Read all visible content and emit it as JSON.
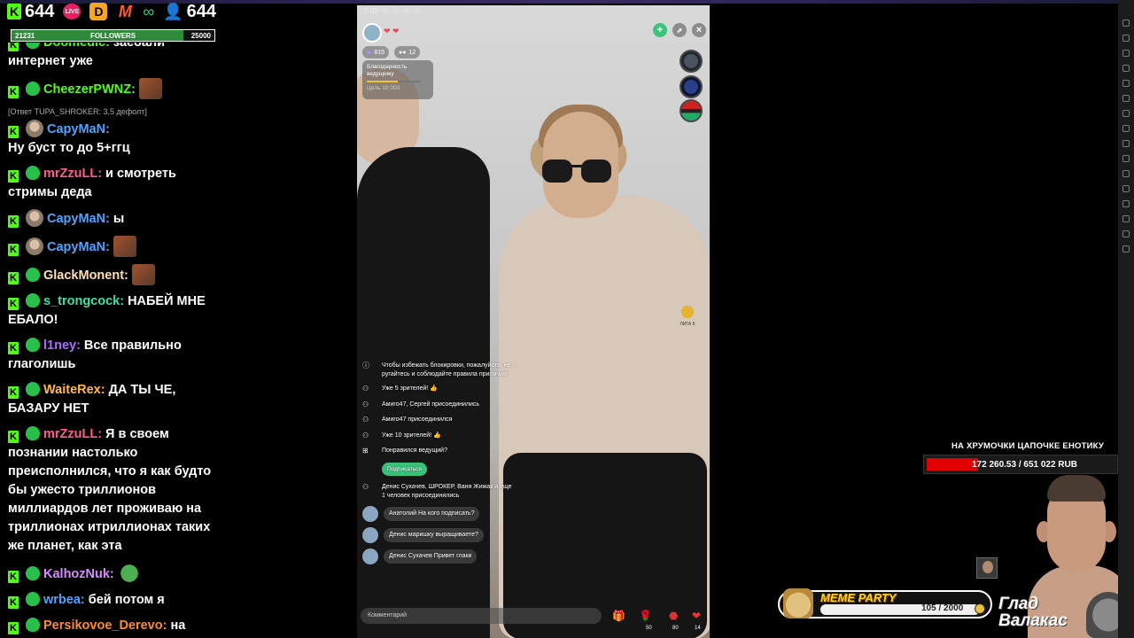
{
  "topbar": {
    "kick_count": "644",
    "live_badge": "LIVE",
    "viewer_count": "644"
  },
  "followers": {
    "current": "21231",
    "label": "FOLLOWERS",
    "goal": "25000",
    "progress": 0.849
  },
  "chat": {
    "messages": [
      {
        "user": "Doomedic:",
        "text": "заебали",
        "cont": "интернет уже",
        "color": "#53fc18"
      },
      {
        "user": "CheezerPWNZ:",
        "text": "",
        "color": "#53fc18"
      },
      {
        "user": "CapyMaN:",
        "text": "",
        "color": "#4ea5ff",
        "reply": "[Ответ TUPA_SHROKER: 3,5 дефолт]",
        "cont": "Ну буст то до 5+ггц"
      },
      {
        "user": "mrZzuLL:",
        "text": "и смотреть",
        "cont": "стримы деда",
        "color": "#ff5c8a"
      },
      {
        "user": "CapyMaN:",
        "text": "ы",
        "color": "#4ea5ff"
      },
      {
        "user": "CapyMaN:",
        "text": "",
        "color": "#4ea5ff"
      },
      {
        "user": "GlackMonent:",
        "text": "",
        "color": "#ffe0b0"
      },
      {
        "user": "s_trongcock:",
        "text": "НАБЕЙ МНЕ",
        "cont": "ЕБАЛО!",
        "color": "#3ee0a0"
      },
      {
        "user": "l1ney:",
        "text": "Все правильно",
        "cont": "глаголишь",
        "color": "#a96cff"
      },
      {
        "user": "WaiteRex:",
        "text": "ДА ТЫ ЧЕ,",
        "cont": "БАЗАРУ НЕТ",
        "color": "#ffb84a"
      },
      {
        "user": "mrZzuLL:",
        "text": "Я в своем",
        "cont": "познании настолько преисполнился, что я как будто бы ужесто триллионов миллиардов лет проживаю на триллионах итриллионах таких же планет, как эта",
        "color": "#ff5c8a"
      },
      {
        "user": "KalhozNuk:",
        "text": "",
        "color": "#d58cff"
      },
      {
        "user": "wrbea:",
        "text": "бей потом я",
        "color": "#4ea5ff"
      },
      {
        "user": "Persikovoe_Derevo:",
        "text": "на",
        "cont": "зарплате)))",
        "color": "#ff8c2a"
      }
    ]
  },
  "phone": {
    "time": "7:02",
    "pill_815": "815",
    "pill_12": "12",
    "thanks_title": "Благодарность ведущему",
    "thanks_goal": "Цель 10 000",
    "league": "ЛИГА 5",
    "system_msg": "Чтобы избежать блокировки, пожалуйста, не ругайтесь и соблюдайте правила приличия",
    "events": [
      "Уже 5 зрителей! 👍",
      "Амиго47, Сергей присоединились",
      "Амиго47 присоединился",
      "Уже 10 зрителей! 👍",
      "Понравился ведущий?"
    ],
    "subscribe_label": "Подписаться",
    "joined": "Денис Сухачев, ШРОКЕР, Ваня Жижак и еще 1 человек присоединились",
    "comments": [
      {
        "name": "Анатолий",
        "text": "На кого подписать?"
      },
      {
        "name": "Денис",
        "text": "маришку выращиваете?"
      },
      {
        "name": "Денис Сухачев",
        "text": "Привет глаки"
      }
    ],
    "input_placeholder": "Комментарий",
    "bottom_counts": [
      "50",
      "80",
      "14"
    ]
  },
  "goal": {
    "title": "НА ХРУМОЧКИ ЦАПОЧКЕ ЕНОТИКУ",
    "amount": "172 260.53 / 651 022 RUB",
    "progress": 0.265
  },
  "meme_party": {
    "title": "MEME PARTY",
    "count": "105 / 2000"
  },
  "streamer": {
    "name_line1": "Глад",
    "name_line2": "Валакас"
  }
}
